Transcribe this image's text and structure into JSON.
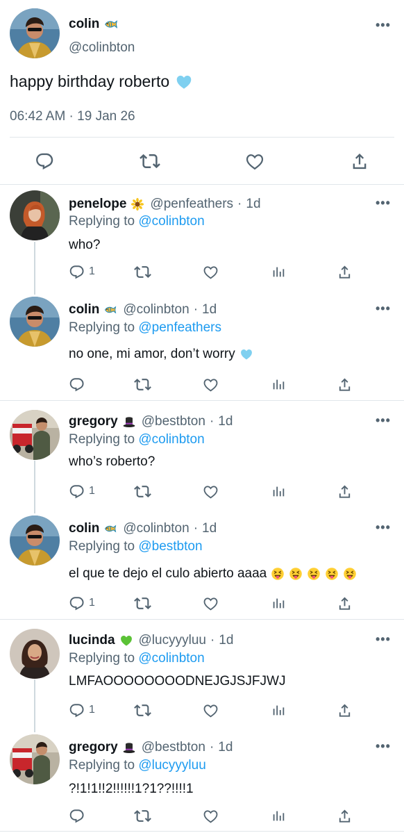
{
  "main": {
    "name": "colin",
    "handle": "@colinbton",
    "text": "happy birthday roberto",
    "time": "06:42 AM · 19 Jan 26",
    "more": "•••"
  },
  "replies": [
    {
      "name": "penelope",
      "handle": "@penfeathers",
      "dot": "·",
      "age": "1d",
      "replying_prefix": "Replying to",
      "replying_to": "@colinbton",
      "text": "who?",
      "reply_count": "1",
      "more": "•••"
    },
    {
      "name": "colin",
      "handle": "@colinbton",
      "dot": "·",
      "age": "1d",
      "replying_prefix": "Replying to",
      "replying_to": "@penfeathers",
      "text": "no one, mi amor, don’t worry",
      "reply_count": "",
      "more": "•••"
    },
    {
      "name": "gregory",
      "handle": "@bestbton",
      "dot": "·",
      "age": "1d",
      "replying_prefix": "Replying to",
      "replying_to": "@colinbton",
      "text": "who’s roberto?",
      "reply_count": "1",
      "more": "•••"
    },
    {
      "name": "colin",
      "handle": "@colinbton",
      "dot": "·",
      "age": "1d",
      "replying_prefix": "Replying to",
      "replying_to": "@bestbton",
      "text": "el que te dejo el culo abierto aaaa",
      "reply_count": "1",
      "more": "•••"
    },
    {
      "name": "lucinda",
      "handle": "@lucyyyluu",
      "dot": "·",
      "age": "1d",
      "replying_prefix": "Replying to",
      "replying_to": "@colinbton",
      "text": "LMFAOOOOOOOODNEJGJSJFJWJ",
      "reply_count": "1",
      "more": "•••"
    },
    {
      "name": "gregory",
      "handle": "@bestbton",
      "dot": "·",
      "age": "1d",
      "replying_prefix": "Replying to",
      "replying_to": "@lucyyyluu",
      "text": "?!1!1!!2!!!!!!1?1??!!!!1",
      "reply_count": "",
      "more": "•••"
    }
  ],
  "colors": {
    "link": "#1d9bf0",
    "muted": "#536471",
    "divider": "#e1e6ea"
  }
}
